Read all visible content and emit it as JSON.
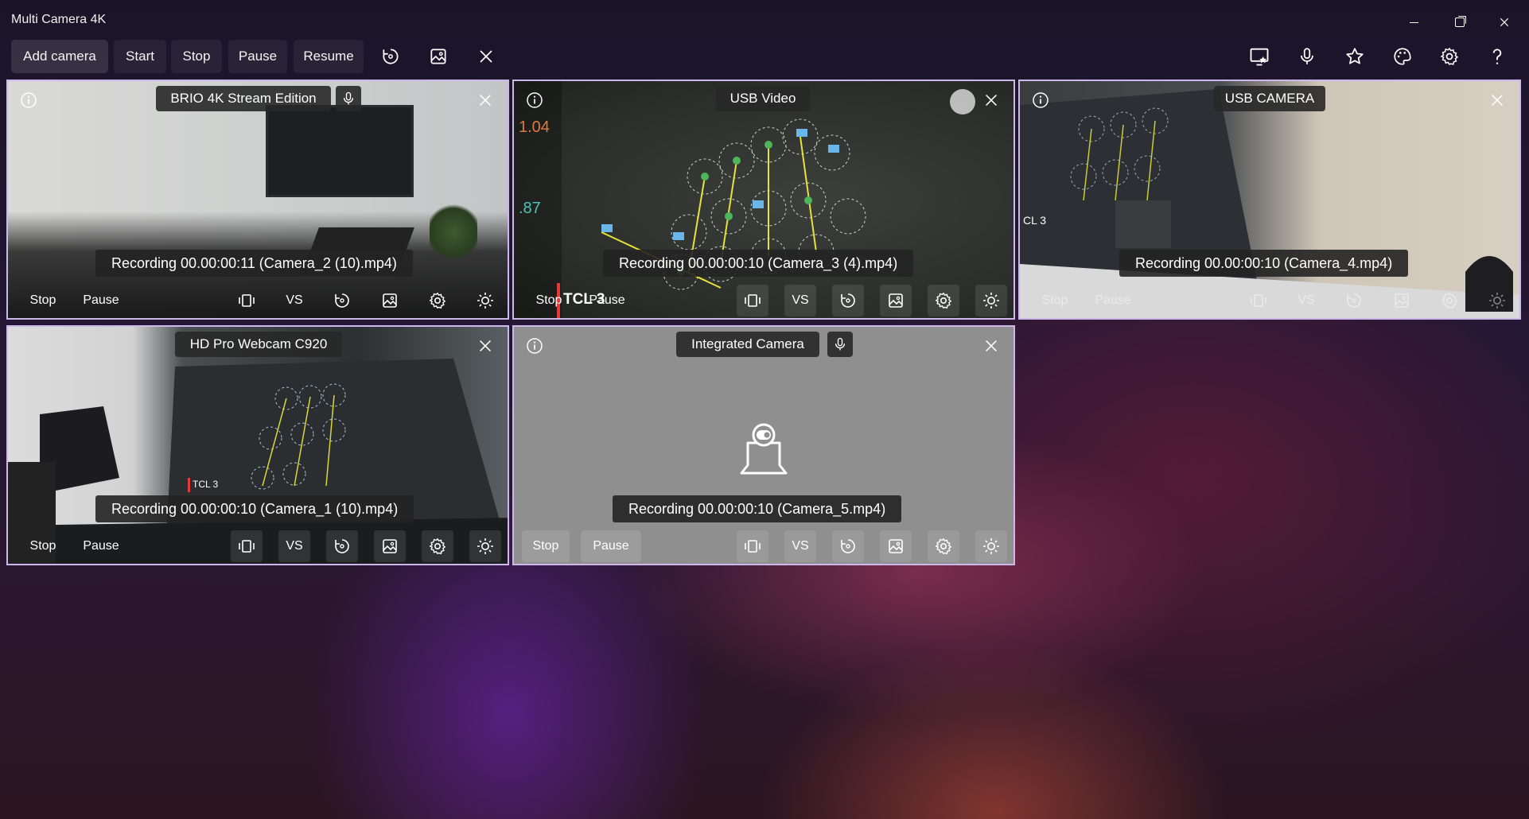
{
  "window": {
    "title": "Multi Camera 4K"
  },
  "toolbar": {
    "add_camera": "Add camera",
    "start": "Start",
    "stop": "Stop",
    "pause": "Pause",
    "resume": "Resume"
  },
  "panels": [
    {
      "name": "BRIO 4K Stream Edition",
      "recording": "Recording 00.00:00:11 (Camera_2 (10).mp4)",
      "stop": "Stop",
      "pause": "Pause",
      "vs": "VS"
    },
    {
      "name": "USB Video",
      "recording": "Recording 00.00:00:10 (Camera_3 (4).mp4)",
      "stop": "Stop",
      "pause": "Pause",
      "vs": "VS",
      "overlay_text": "TCL 3"
    },
    {
      "name": "USB CAMERA",
      "recording": "Recording 00.00:00:10 (Camera_4.mp4)",
      "stop": "Stop",
      "pause": "Pause",
      "vs": "VS"
    },
    {
      "name": "HD Pro Webcam C920",
      "recording": "Recording 00.00:00:10 (Camera_1 (10).mp4)",
      "stop": "Stop",
      "pause": "Pause",
      "vs": "VS"
    },
    {
      "name": "Integrated Camera",
      "recording": "Recording 00.00:00:10 (Camera_5.mp4)",
      "stop": "Stop",
      "pause": "Pause",
      "vs": "VS"
    }
  ],
  "icons": {
    "toolbar": [
      "rotate-icon",
      "snapshot-icon",
      "close-icon"
    ],
    "toolbar_right": [
      "screen-capture-icon",
      "microphone-icon",
      "star-icon",
      "palette-icon",
      "settings-icon",
      "help-icon"
    ],
    "panel": [
      "info-icon",
      "close-icon",
      "fit-icon",
      "rotate-icon",
      "snapshot-icon",
      "settings-icon",
      "brightness-icon"
    ]
  },
  "colors": {
    "panel_border": "#cdb8ec",
    "placeholder_bg": "#8f8f8f"
  }
}
